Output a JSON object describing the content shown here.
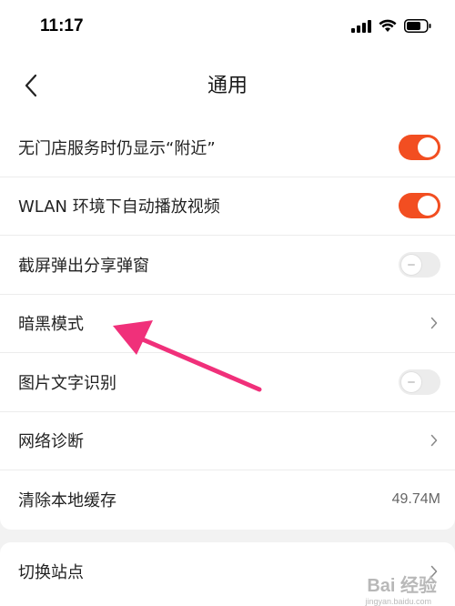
{
  "status_bar": {
    "time": "11:17",
    "icons": [
      "signal-icon",
      "wifi-icon",
      "battery-icon"
    ]
  },
  "nav": {
    "title": "通用",
    "back_icon": "chevron-left-icon"
  },
  "settings": [
    {
      "label": "无门店服务时仍显示“附近”",
      "control": "toggle",
      "on": true
    },
    {
      "label": "WLAN 环境下自动播放视频",
      "control": "toggle",
      "on": true
    },
    {
      "label": "截屏弹出分享弹窗",
      "control": "toggle",
      "on": false
    },
    {
      "label": "暗黑模式",
      "control": "chevron"
    },
    {
      "label": "图片文字识别",
      "control": "toggle",
      "on": false
    },
    {
      "label": "网络诊断",
      "control": "chevron"
    },
    {
      "label": "清除本地缓存",
      "control": "value",
      "value": "49.74M"
    }
  ],
  "settings_2": [
    {
      "label": "切换站点",
      "control": "chevron"
    }
  ],
  "colors": {
    "toggle_on": "#f24e21",
    "toggle_off": "#ececec",
    "annotation_arrow": "#f0307a"
  },
  "watermark": {
    "text": "Bai 经验",
    "sub": "jingyan.baidu.com"
  }
}
